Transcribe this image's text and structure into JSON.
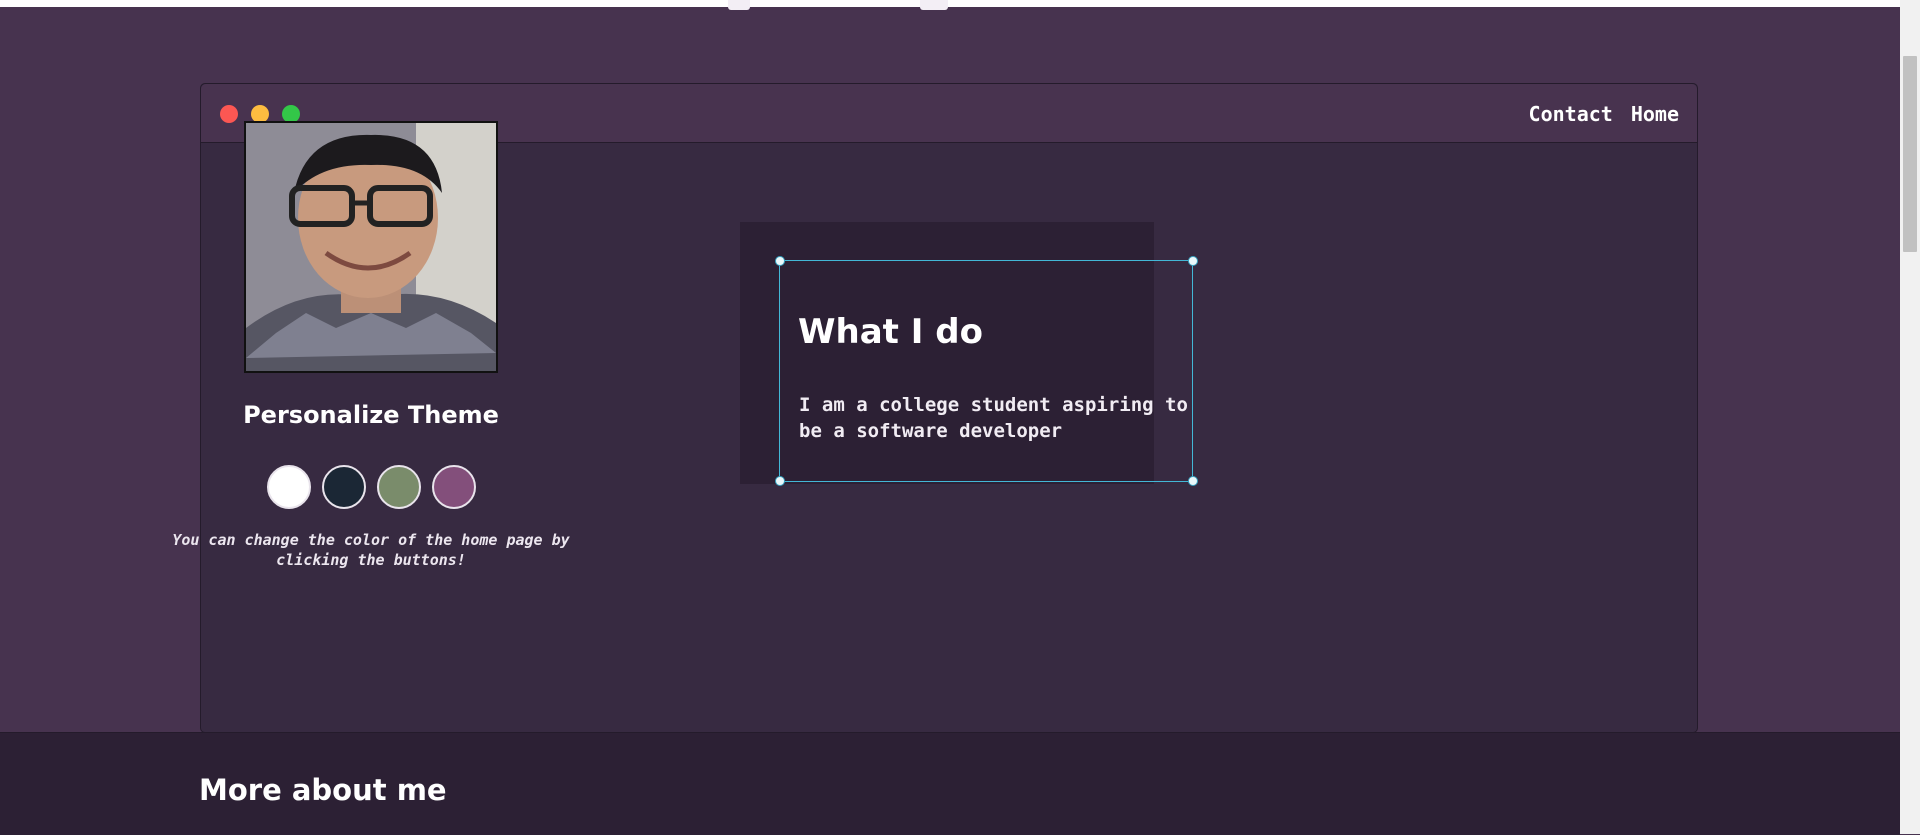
{
  "window": {
    "nav": {
      "contact": "Contact",
      "home": "Home"
    }
  },
  "profile": {
    "photo_alt": "Profile photo"
  },
  "theme": {
    "title": "Personalize Theme",
    "note": "You can change the color of the home page by clicking the buttons!",
    "colors": [
      "#ffffff",
      "#1b2735",
      "#7a8c6b",
      "#834f7b"
    ]
  },
  "card": {
    "title": "What I do",
    "text": "I am a college student aspiring to be a software developer"
  },
  "footer": {
    "title": "More about me"
  },
  "palette": {
    "page_bg": "#47334f",
    "window_bg": "#372a41",
    "card_bg": "#2c2034",
    "selection": "#43b7d6"
  },
  "icons": {
    "window_controls": [
      "close-dot",
      "minimize-dot",
      "maximize-dot"
    ]
  }
}
